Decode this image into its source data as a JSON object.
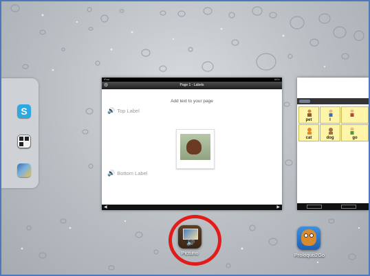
{
  "switcher": {
    "left_card_apps": [
      "skype-icon",
      "qr-reader-icon",
      "photo-app-icon"
    ],
    "main_card": {
      "status_left": "iPad",
      "status_right": "66%",
      "title": "Page 1 - Labels",
      "hint": "Add text to your page",
      "top_label": "Top Label",
      "bottom_label": "Bottom Label"
    },
    "right_card": {
      "cells": [
        {
          "word": "pet"
        },
        {
          "word": "I"
        },
        {
          "word": ""
        },
        {
          "word": "cat"
        },
        {
          "word": "dog"
        },
        {
          "word": "go"
        }
      ]
    }
  },
  "dock": {
    "apps": [
      {
        "name": "Picturio",
        "icon": "picturio-app-icon"
      },
      {
        "name": "Proloquo2Go",
        "icon": "proloquo2go-app-icon"
      }
    ]
  },
  "colors": {
    "highlight_ring": "#e21b1b",
    "frame_border": "#4a78b8"
  }
}
